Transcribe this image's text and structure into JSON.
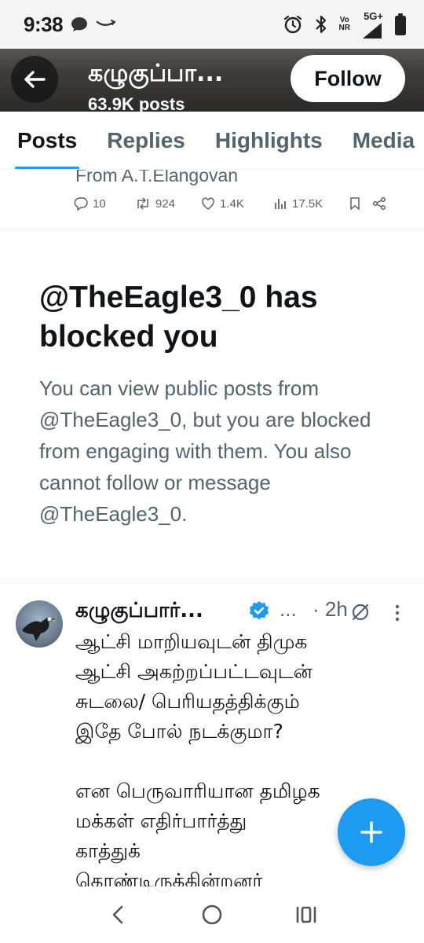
{
  "status_bar": {
    "time": "9:38",
    "network_vo": "Vo",
    "network_nr": "NR",
    "network_5g": "5G+"
  },
  "header": {
    "title": "கழுகுப்பா...",
    "subtitle": "63.9K posts",
    "follow_label": "Follow"
  },
  "tabs": [
    {
      "label": "Posts",
      "active": true
    },
    {
      "label": "Replies",
      "active": false
    },
    {
      "label": "Highlights",
      "active": false
    },
    {
      "label": "Media",
      "active": false
    }
  ],
  "prev_tweet": {
    "from_text": "From A.T.Elangovan",
    "replies": "10",
    "reposts": "924",
    "likes": "1.4K",
    "views": "17.5K"
  },
  "blocked_notice": {
    "title": "@TheEagle3_0 has blocked you",
    "body": "You can view public posts from @TheEagle3_0, but you are blocked from engaging with them. You also cannot follow or message @TheEagle3_0."
  },
  "tweet": {
    "author_name": "கழுகுப்பார்...",
    "handle_truncated": "...",
    "separator": "·",
    "time": "2h",
    "text": "ஆட்சி மாறியவுடன் திமுக\nஆட்சி அகற்றப்பட்டவுடன்\nசுடலை/ பெரியதத்திக்கும்\nஇதே போல் நடக்குமா?\n\nஎன பெருவாரியான தமிழக\nமக்கள் எதிர்பார்த்து\nகாத்துக்\nகொண்டிருக்கின்றனர்"
  },
  "colors": {
    "accent": "#1d9bf0",
    "text_primary": "#0f1419",
    "text_secondary": "#536471"
  },
  "icons": {
    "back": "arrow-left-icon",
    "compose": "plus-icon",
    "nav_back": "chevron-left-icon",
    "nav_home": "circle-icon",
    "nav_recents": "recents-icon"
  }
}
